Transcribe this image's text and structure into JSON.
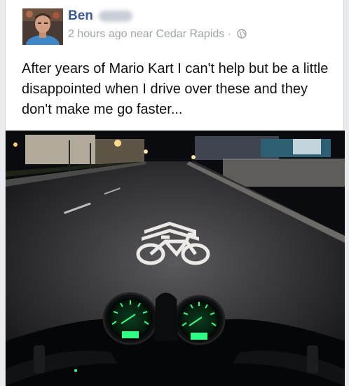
{
  "post": {
    "author_name": "Ben",
    "timestamp": "2 hours ago",
    "location": "near Cedar Rapids",
    "separator": "·",
    "message": "After years of Mario Kart I can't help but be a little disappointed when I drive over these and they don't make me go faster..."
  },
  "icons": {
    "privacy": "globe-icon",
    "avatar": "profile-photo"
  },
  "colors": {
    "name_link": "#3b5998",
    "meta_text": "#a0a4ab",
    "card_bg": "#ffffff",
    "page_bg": "#e9ebee",
    "gauge_green": "#2bff86"
  }
}
